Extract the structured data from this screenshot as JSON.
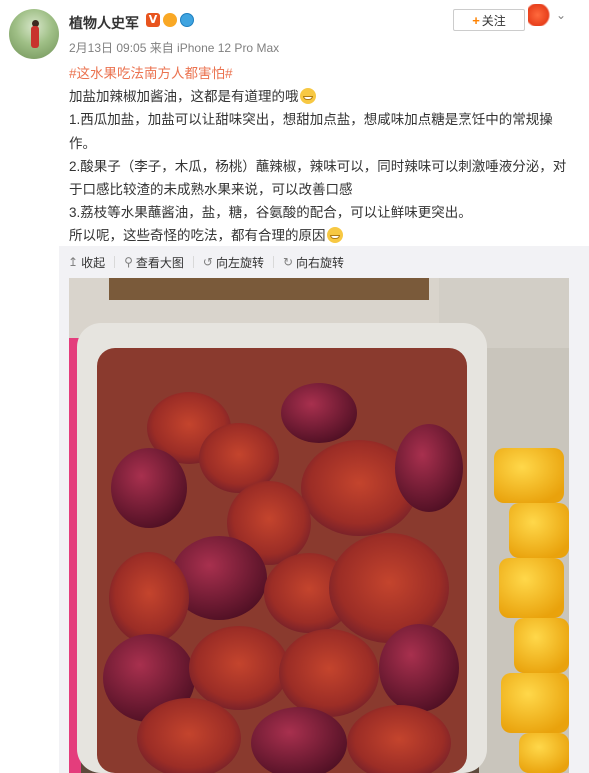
{
  "post": {
    "username": "植物人史军",
    "verified_badge": "V",
    "meta": "2月13日 09:05 来自 iPhone 12 Pro Max",
    "follow_label": "关注",
    "topic": "#这水果吃法南方人都害怕#",
    "lines": [
      "加盐加辣椒加酱油，这都是有道理的哦",
      "1.西瓜加盐，加盐可以让甜味突出，想甜加点盐，想咸味加点糖是烹饪中的常规操作。",
      "2.酸果子（李子，木瓜，杨桃）蘸辣椒，辣味可以，同时辣味可以刺激唾液分泌，对于口感比较渣的未成熟水果来说，可以改善口感",
      "3.荔枝等水果蘸酱油，盐，糖，谷氨酸的配合，可以让鲜味更突出。",
      "所以呢，这些奇怪的吃法，都有合理的原因"
    ]
  },
  "toolbar": {
    "collapse": "收起",
    "view_large": "查看大图",
    "rotate_left": "向左旋转",
    "rotate_right": "向右旋转"
  },
  "icons": {
    "collapse": "arrow-up-icon",
    "view_large": "magnifier-icon",
    "rotate_left": "rotate-left-icon",
    "rotate_right": "rotate-right-icon"
  },
  "colors": {
    "topic_link": "#eb7350",
    "follow_plus": "#ff8200",
    "panel_bg": "#f2f2f5",
    "meta_text": "#808080"
  }
}
